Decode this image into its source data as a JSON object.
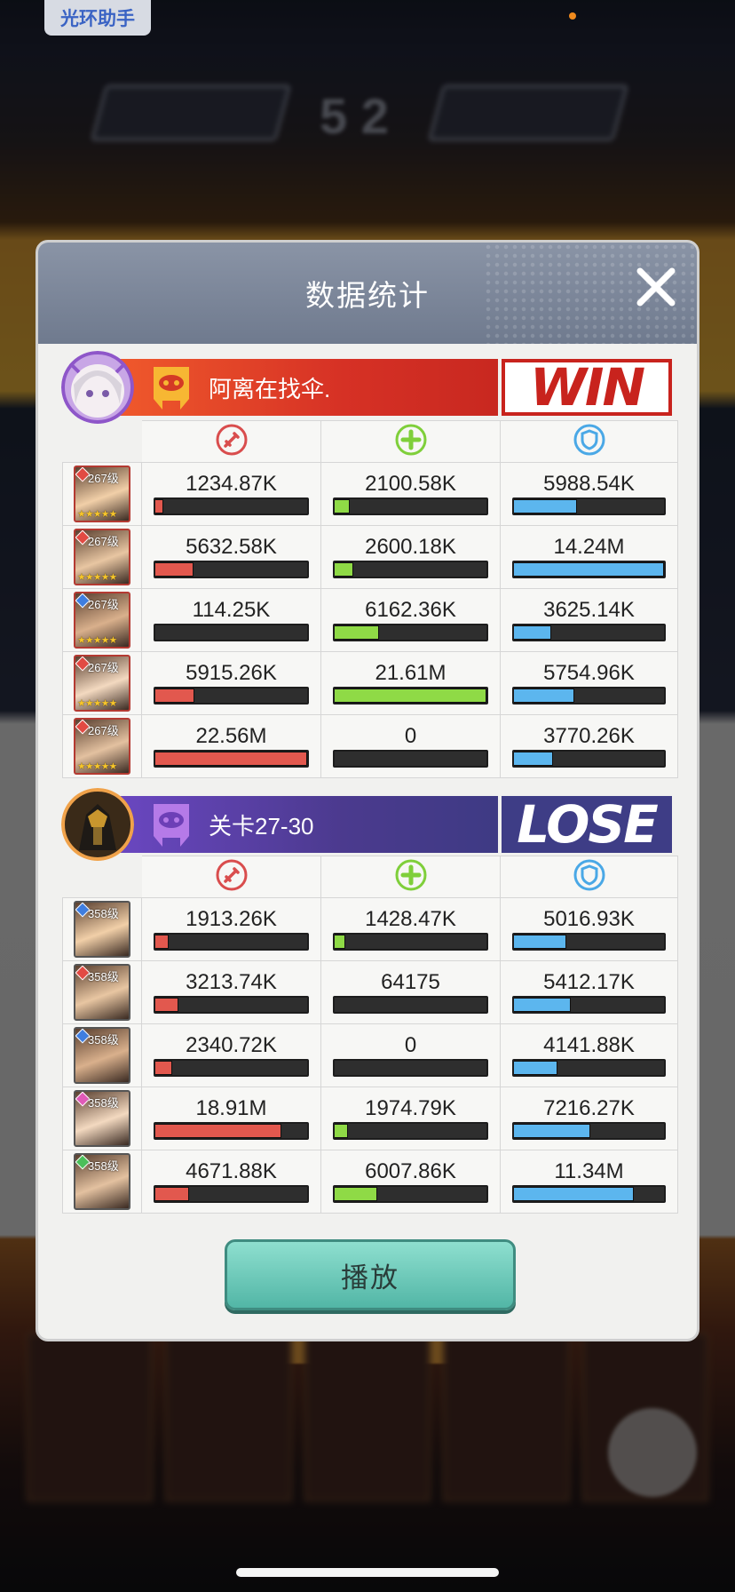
{
  "helper_label": "光环助手",
  "dialog": {
    "title": "数据统计",
    "play_label": "播放"
  },
  "colors": {
    "damage": "#e2584e",
    "heal": "#8fda46",
    "shield": "#5cb6ee",
    "win": "#c8231d",
    "lose": "#3e3d86"
  },
  "columns": [
    "damage-icon",
    "heal-icon",
    "shield-icon"
  ],
  "team1": {
    "name": "阿离在找伞.",
    "result": "WIN",
    "heroes": [
      {
        "level": "267级",
        "element": "fire",
        "damage": "1234.87K",
        "heal": "2100.58K",
        "shield": "5988.54K",
        "damage_frac": 0.055,
        "heal_frac": 0.1,
        "shield_frac": 0.42
      },
      {
        "level": "267级",
        "element": "fire",
        "damage": "5632.58K",
        "heal": "2600.18K",
        "shield": "14.24M",
        "damage_frac": 0.25,
        "heal_frac": 0.12,
        "shield_frac": 1.0
      },
      {
        "level": "267级",
        "element": "water",
        "damage": "114.25K",
        "heal": "6162.36K",
        "shield": "3625.14K",
        "damage_frac": 0.0,
        "heal_frac": 0.29,
        "shield_frac": 0.25
      },
      {
        "level": "267级",
        "element": "fire",
        "damage": "5915.26K",
        "heal": "21.61M",
        "shield": "5754.96K",
        "damage_frac": 0.26,
        "heal_frac": 1.0,
        "shield_frac": 0.4
      },
      {
        "level": "267级",
        "element": "fire",
        "damage": "22.56M",
        "heal": "0",
        "shield": "3770.26K",
        "damage_frac": 1.0,
        "heal_frac": 0.0,
        "shield_frac": 0.26
      }
    ]
  },
  "team2": {
    "name": "关卡27-30",
    "result": "LOSE",
    "heroes": [
      {
        "level": "358级",
        "element": "water",
        "damage": "1913.26K",
        "heal": "1428.47K",
        "shield": "5016.93K",
        "damage_frac": 0.09,
        "heal_frac": 0.07,
        "shield_frac": 0.35
      },
      {
        "level": "358级",
        "element": "fire",
        "damage": "3213.74K",
        "heal": "64175",
        "shield": "5412.17K",
        "damage_frac": 0.15,
        "heal_frac": 0.0,
        "shield_frac": 0.38
      },
      {
        "level": "358级",
        "element": "water",
        "damage": "2340.72K",
        "heal": "0",
        "shield": "4141.88K",
        "damage_frac": 0.11,
        "heal_frac": 0.0,
        "shield_frac": 0.29
      },
      {
        "level": "358级",
        "element": "light",
        "damage": "18.91M",
        "heal": "1974.79K",
        "shield": "7216.27K",
        "damage_frac": 0.83,
        "heal_frac": 0.09,
        "shield_frac": 0.51
      },
      {
        "level": "358级",
        "element": "wood",
        "damage": "4671.88K",
        "heal": "6007.86K",
        "shield": "11.34M",
        "damage_frac": 0.22,
        "heal_frac": 0.28,
        "shield_frac": 0.8
      }
    ]
  }
}
